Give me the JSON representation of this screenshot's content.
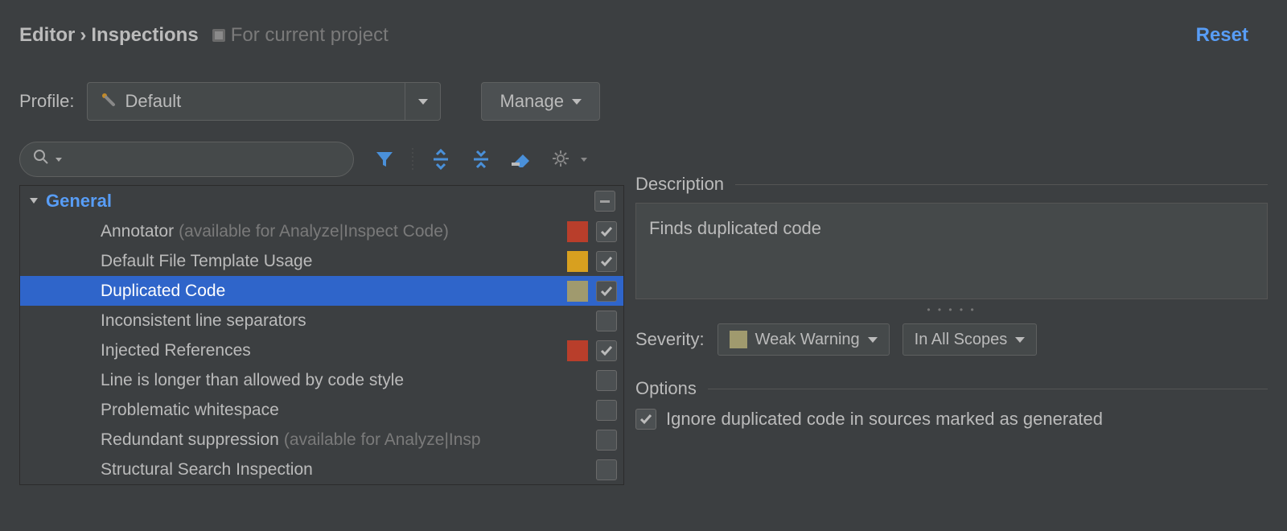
{
  "breadcrumb": {
    "parent": "Editor",
    "current": "Inspections",
    "scope": "For current project"
  },
  "reset": "Reset",
  "profile": {
    "label": "Profile:",
    "value": "Default"
  },
  "manage": "Manage",
  "tree": {
    "group": "General",
    "items": [
      {
        "label": "Annotator",
        "hint": "(available for Analyze|Inspect Code)",
        "severityColor": "#b93e2b",
        "checked": true,
        "selected": false
      },
      {
        "label": "Default File Template Usage",
        "hint": "",
        "severityColor": "#d8a01f",
        "checked": true,
        "selected": false
      },
      {
        "label": "Duplicated Code",
        "hint": "",
        "severityColor": "#a09a6e",
        "checked": true,
        "selected": true
      },
      {
        "label": "Inconsistent line separators",
        "hint": "",
        "severityColor": "",
        "checked": false,
        "selected": false
      },
      {
        "label": "Injected References",
        "hint": "",
        "severityColor": "#b93e2b",
        "checked": true,
        "selected": false
      },
      {
        "label": "Line is longer than allowed by code style",
        "hint": "",
        "severityColor": "",
        "checked": false,
        "selected": false
      },
      {
        "label": "Problematic whitespace",
        "hint": "",
        "severityColor": "",
        "checked": false,
        "selected": false
      },
      {
        "label": "Redundant suppression",
        "hint": "(available for Analyze|Insp",
        "severityColor": "",
        "checked": false,
        "selected": false
      },
      {
        "label": "Structural Search Inspection",
        "hint": "",
        "severityColor": "",
        "checked": false,
        "selected": false
      }
    ]
  },
  "details": {
    "descriptionHeading": "Description",
    "descriptionText": "Finds duplicated code",
    "severityLabel": "Severity:",
    "severityValue": "Weak Warning",
    "severityColor": "#a09a6e",
    "scopeValue": "In All Scopes",
    "optionsHeading": "Options",
    "optionChecked": true,
    "optionText": "Ignore duplicated code in sources marked as generated"
  }
}
